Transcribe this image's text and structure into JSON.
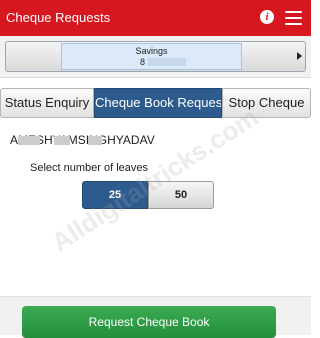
{
  "header": {
    "title": "Cheque Requests",
    "info_icon": "info-icon",
    "info_glyph": "i",
    "menu_icon": "hamburger-menu-icon",
    "color": "#d7171f"
  },
  "account": {
    "type": "Savings",
    "number_visible": "8"
  },
  "tabs": [
    {
      "label": "Status Enquiry",
      "active": false
    },
    {
      "label": "Cheque Book Request",
      "active": true
    },
    {
      "label": "Stop Cheque",
      "active": false
    }
  ],
  "holder_name": "AMESHYAMSINGHYADAV",
  "leaves": {
    "label": "Select number of leaves",
    "options": [
      "25",
      "50"
    ],
    "selected": "25"
  },
  "request_button_label": "Request Cheque Book",
  "watermark": "Alldigitaltricks.com",
  "colors": {
    "accent_blue": "#2e5b8d",
    "button_green": "#2e9d47"
  }
}
